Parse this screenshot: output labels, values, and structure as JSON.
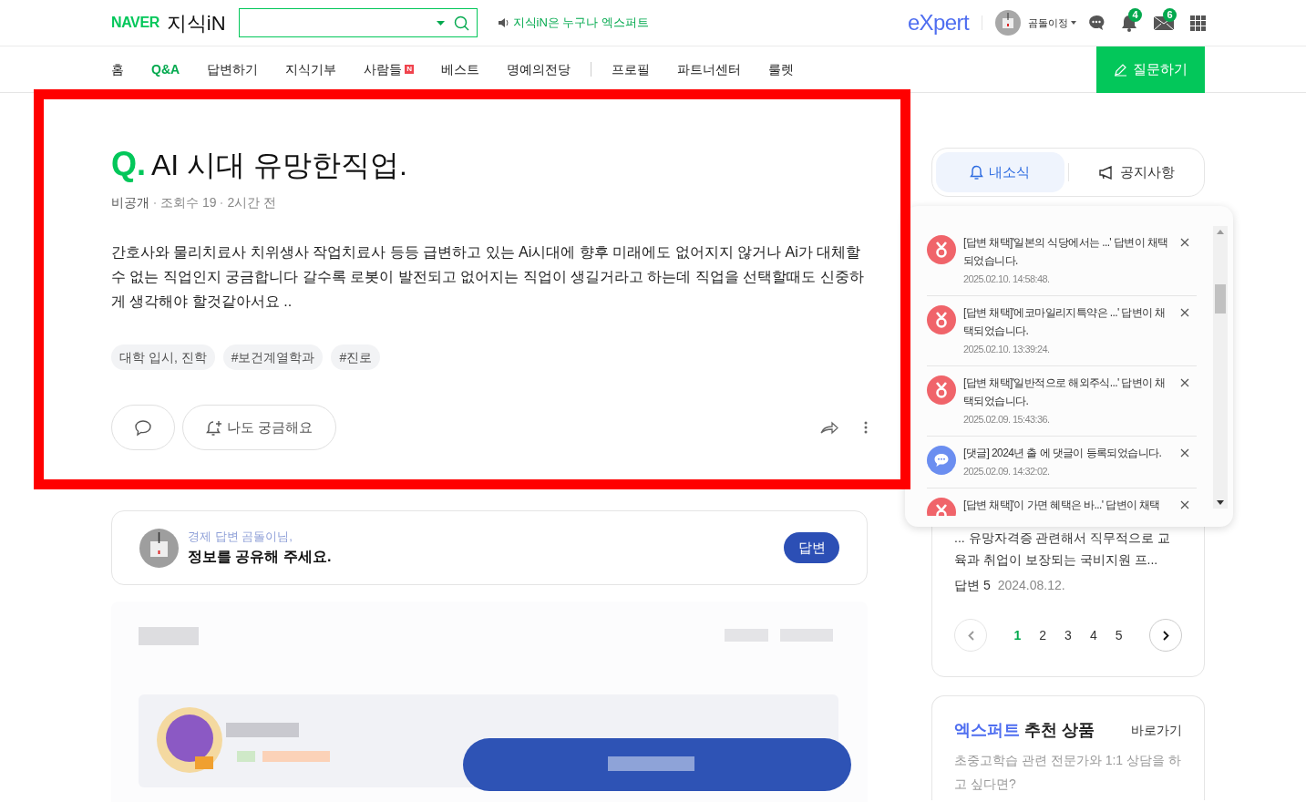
{
  "header": {
    "logo_brand": "NAVER",
    "logo_service": "지식iN",
    "slogan": "지식iN은 누구나 엑스퍼트",
    "expert_logo": "eXpert",
    "user_name": "곰돌이정",
    "notification_count": "4",
    "mail_count": "6"
  },
  "nav": {
    "items": [
      {
        "label": "홈",
        "selected": false,
        "new": false,
        "divider_before": false
      },
      {
        "label": "Q&A",
        "selected": true,
        "new": false,
        "divider_before": false
      },
      {
        "label": "답변하기",
        "selected": false,
        "new": false,
        "divider_before": false
      },
      {
        "label": "지식기부",
        "selected": false,
        "new": false,
        "divider_before": false
      },
      {
        "label": "사람들",
        "selected": false,
        "new": true,
        "divider_before": false
      },
      {
        "label": "베스트",
        "selected": false,
        "new": false,
        "divider_before": false
      },
      {
        "label": "명예의전당",
        "selected": false,
        "new": false,
        "divider_before": false
      },
      {
        "label": "프로필",
        "selected": false,
        "new": false,
        "divider_before": true
      },
      {
        "label": "파트너센터",
        "selected": false,
        "new": false,
        "divider_before": false
      },
      {
        "label": "룰렛",
        "selected": false,
        "new": false,
        "divider_before": false
      }
    ],
    "new_badge": "N",
    "ask_button": "질문하기"
  },
  "question": {
    "q_mark": "Q.",
    "title": "AI 시대 유망한직업.",
    "meta": [
      "비공개",
      "조회수 19",
      "2시간 전"
    ],
    "body": "간호사와 물리치료사 치위생사 작업치료사 등등 급변하고 있는 Ai시대에 향후 미래에도 없어지지 않거나 Ai가 대체할수 없는 직업인지 궁금합니다 갈수록 로봇이 발전되고 없어지는 직업이 생길거라고 하는데 직업을 선택할때도 신중하게 생각해야 할것같아서요 ..",
    "tags": [
      "대학 입시, 진학",
      "#보건계열학과",
      "#진로"
    ],
    "curious_button": "나도 궁금해요"
  },
  "answer_prompt": {
    "greeting": "경제 답변 곰돌이님,",
    "message": "정보를 공유해 주세요.",
    "button": "답변"
  },
  "sidebar": {
    "tabs": [
      {
        "label": "내소식",
        "selected": true
      },
      {
        "label": "공지사항",
        "selected": false
      }
    ],
    "related": {
      "text": "... 유망자격증 관련해서 직무적으로 교육과 취업이 보장되는 국비지원 프...",
      "answers": "답변 5",
      "date": "2024.08.12.",
      "pages": [
        {
          "label": "1",
          "selected": true
        },
        {
          "label": "2",
          "selected": false
        },
        {
          "label": "3",
          "selected": false
        },
        {
          "label": "4",
          "selected": false
        },
        {
          "label": "5",
          "selected": false
        }
      ]
    },
    "expert": {
      "title_accent": "엑스퍼트",
      "title_rest": "추천 상품",
      "link": "바로가기",
      "desc": "초중고학습 관련 전문가와 1:1 상담을 하고 싶다면?"
    }
  },
  "notifications": [
    {
      "kind": "adopt",
      "text": "[답변 채택]'일본의 식당에서는 ...' 답변이 채택되었습니다.",
      "time": "2025.02.10. 14:58:48."
    },
    {
      "kind": "adopt",
      "text": "[답변 채택]'에코마일리지특약은 ...' 답변이 채택되었습니다.",
      "time": "2025.02.10. 13:39:24."
    },
    {
      "kind": "adopt",
      "text": "[답변 채택]'일반적으로 해외주식...' 답변이 채택되었습니다.",
      "time": "2025.02.09. 15:43:36."
    },
    {
      "kind": "comment",
      "text": "[댓글] 2024년 출 에 댓글이 등록되었습니다.",
      "time": "2025.02.09. 14:32:02."
    },
    {
      "kind": "adopt",
      "text": "[답변 채택]'이 가면 혜택은 바...' 답변이 채택"
    }
  ]
}
